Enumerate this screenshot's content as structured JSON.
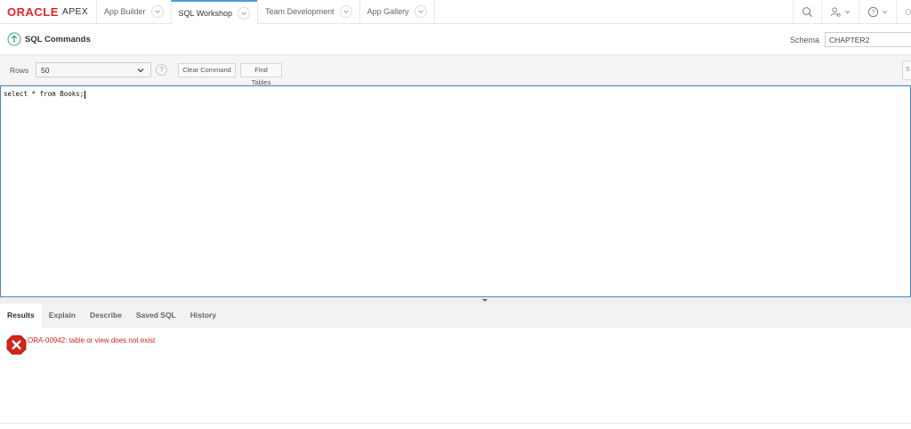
{
  "app": {
    "brand": "ORACLE",
    "product": "APEX"
  },
  "nav": {
    "tabs": [
      {
        "label": "App Builder"
      },
      {
        "label": "SQL Workshop"
      },
      {
        "label": "Team Development"
      },
      {
        "label": "App Gallery"
      }
    ],
    "active_tab": "SQL Workshop",
    "right_icons": [
      "search-icon",
      "user-icon",
      "help-icon",
      "circle-icon"
    ]
  },
  "page": {
    "title": "SQL Commands",
    "schema_label": "Schema",
    "schema_value": "CHAPTER2"
  },
  "toolbar": {
    "rows_label": "Rows",
    "rows_value": "50",
    "help_symbol": "?",
    "clear_command_label": "Clear Command",
    "find_tables_label": "Find Tables",
    "right_button_label": "S"
  },
  "editor": {
    "sql_text": "select * from Books;"
  },
  "results": {
    "tabs": [
      {
        "label": "Results"
      },
      {
        "label": "Explain"
      },
      {
        "label": "Describe"
      },
      {
        "label": "Saved SQL"
      },
      {
        "label": "History"
      }
    ],
    "active_tab": "Results",
    "error_message": "ORA-00942: table or view does not exist"
  },
  "colors": {
    "oracle_red": "#e5232a",
    "accent_blue": "#4b86c8",
    "error_red": "#d0241b",
    "up_icon_green": "#3aa57a"
  }
}
